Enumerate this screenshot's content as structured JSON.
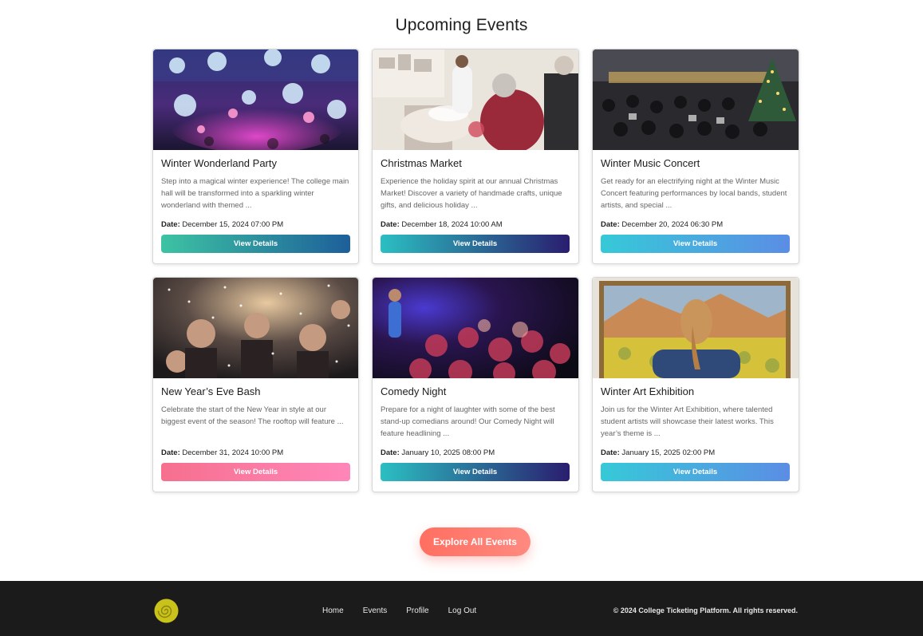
{
  "page": {
    "title": "Upcoming Events"
  },
  "events": [
    {
      "title": "Winter Wonderland Party",
      "description": "Step into a magical winter experience! The college main hall will be transformed into a sparkling winter wonderland with themed ...",
      "date_label": "Date:",
      "date": "December 15, 2024 07:00 PM",
      "button": "View Details",
      "image": "winter-party-hall-photo"
    },
    {
      "title": "Christmas Market",
      "description": "Experience the holiday spirit at our annual Christmas Market! Discover a variety of handmade crafts, unique gifts, and delicious holiday ...",
      "date_label": "Date:",
      "date": "December 18, 2024 10:00 AM",
      "button": "View Details",
      "image": "christmas-market-stall-photo"
    },
    {
      "title": "Winter Music Concert",
      "description": "Get ready for an electrifying night at the Winter Music Concert featuring performances by local bands, student artists, and special ...",
      "date_label": "Date:",
      "date": "December 20, 2024 06:30 PM",
      "button": "View Details",
      "image": "orchestra-concert-photo"
    },
    {
      "title": "New Year’s Eve Bash",
      "description": "Celebrate the start of the New Year in style at our biggest event of the season! The rooftop will feature ...",
      "date_label": "Date:",
      "date": "December 31, 2024 10:00 PM",
      "button": "View Details",
      "image": "confetti-party-photo"
    },
    {
      "title": "Comedy Night",
      "description": "Prepare for a night of laughter with some of the best stand-up comedians around! Our Comedy Night will feature headlining ...",
      "date_label": "Date:",
      "date": "January 10, 2025 08:00 PM",
      "button": "View Details",
      "image": "comedy-stage-photo"
    },
    {
      "title": "Winter Art Exhibition",
      "description": "Join us for the Winter Art Exhibition, where talented student artists will showcase their latest works. This year’s theme is ...",
      "date_label": "Date:",
      "date": "January 15, 2025 02:00 PM",
      "button": "View Details",
      "image": "art-gallery-painting-photo"
    }
  ],
  "explore_button": "Explore All Events",
  "footer": {
    "nav": [
      "Home",
      "Events",
      "Profile",
      "Log Out"
    ],
    "copyright": "© 2024 College Ticketing Platform. All rights reserved.",
    "logo_icon": "spiral-logo-icon"
  },
  "colors": {
    "footer_bg": "#1b1b1b",
    "explore_gradient": [
      "#ff6f61",
      "#ff8a80"
    ],
    "logo": "#c9c21a"
  }
}
